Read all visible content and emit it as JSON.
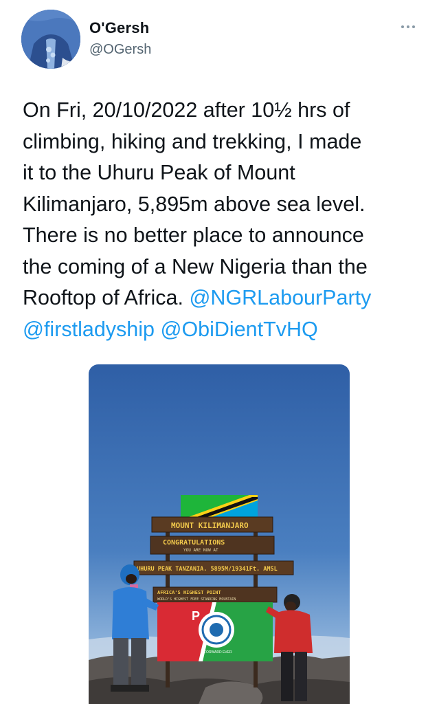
{
  "author": {
    "name": "O'Gersh",
    "handle": "@OGersh"
  },
  "tweet": {
    "lines": [
      "On Fri, 20/10/2022 after 10½ hrs of",
      "climbing, hiking and trekking, I  made",
      "it to the Uhuru Peak of Mount",
      "Kilimanjaro, 5,895m above sea level.",
      "There is no better place to announce",
      "the coming of a New Nigeria than the",
      "Rooftop of Africa. "
    ],
    "mentions": [
      "@NGRLabourParty",
      "@firstladyship",
      "@ObiDientTvHQ"
    ]
  },
  "photo": {
    "sign_board_1": "MOUNT KILIMANJARO",
    "sign_board_2": "CONGRATULATIONS",
    "sign_board_2_sub": "YOU ARE NOW AT",
    "sign_board_3": "UHURU PEAK TANZANIA. 5895M/19341Ft. AMSL",
    "sign_board_4": "AFRICA'S HIGHEST POINT",
    "sign_board_4_sub": "WORLD'S HIGHEST FREE STANDING MOUNTAIN",
    "flag_letter": "P",
    "flag_motto": "FORWARD EVER"
  },
  "colors": {
    "accent": "#1d9bf0",
    "text": "#0f1419",
    "secondary": "#536471",
    "sky_top": "#3563a8",
    "flag_red": "#d92a34",
    "flag_green": "#27a345"
  }
}
